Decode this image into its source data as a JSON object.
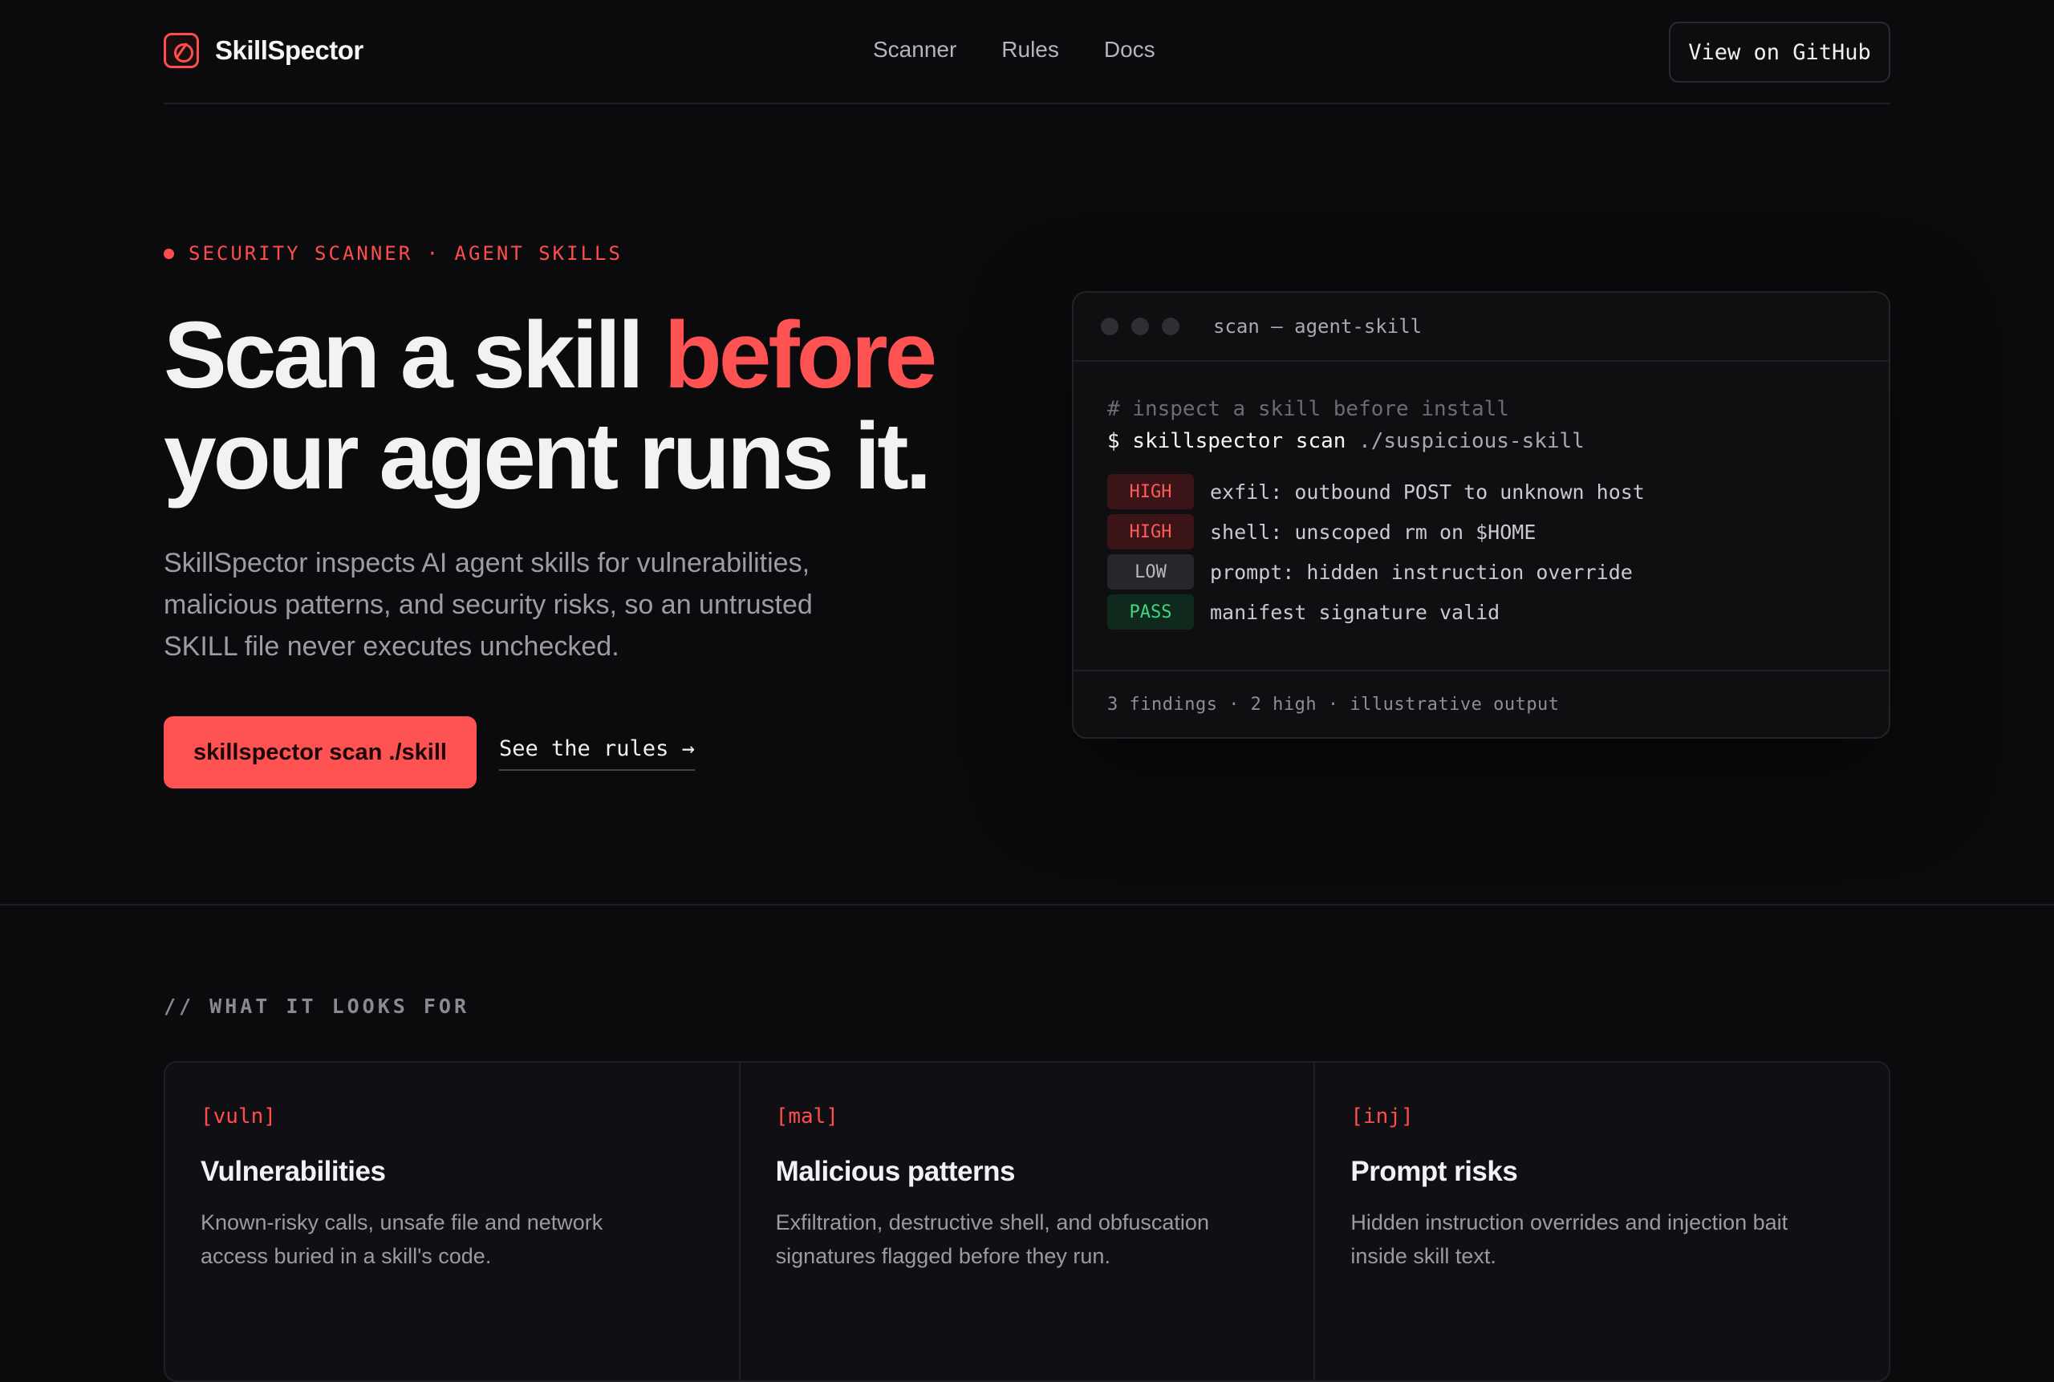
{
  "nav": {
    "brand": "SkillSpector",
    "links": [
      "Scanner",
      "Rules",
      "Docs"
    ],
    "github_label": "View on GitHub"
  },
  "hero": {
    "eyebrow": "SECURITY SCANNER · AGENT SKILLS",
    "title_part1": "Scan a skill ",
    "title_accent": "before",
    "title_part2": "your agent runs it.",
    "subtitle": "SkillSpector inspects AI agent skills for vulnerabilities, malicious patterns, and security risks, so an untrusted SKILL file never executes unchecked.",
    "cta_label": "skillspector scan ./skill",
    "secondary_label": "See the rules →"
  },
  "terminal": {
    "title": "scan — agent-skill",
    "comment": "# inspect a skill before install",
    "command_prefix": "$ skillspector scan",
    "command_arg": " ./suspicious-skill",
    "findings": [
      {
        "level": "HIGH",
        "text": "exfil: outbound POST to unknown host"
      },
      {
        "level": "HIGH",
        "text": "shell: unscoped rm on $HOME"
      },
      {
        "level": "LOW",
        "text": "prompt: hidden instruction override"
      },
      {
        "level": "PASS",
        "text": "manifest signature valid"
      }
    ],
    "footer": "3 findings · 2 high · illustrative output"
  },
  "section": {
    "label": "// WHAT IT LOOKS FOR",
    "cards": [
      {
        "tag": "[vuln]",
        "title": "Vulnerabilities",
        "desc": "Known-risky calls, unsafe file and network access buried in a skill's code."
      },
      {
        "tag": "[mal]",
        "title": "Malicious patterns",
        "desc": "Exfiltration, destructive shell, and obfuscation signatures flagged before they run."
      },
      {
        "tag": "[inj]",
        "title": "Prompt risks",
        "desc": "Hidden instruction overrides and injection bait inside skill text."
      }
    ]
  },
  "colors": {
    "accent": "#ff5252",
    "background": "#0b0b0d",
    "high": "#ff5a5a",
    "pass": "#3fd883"
  }
}
